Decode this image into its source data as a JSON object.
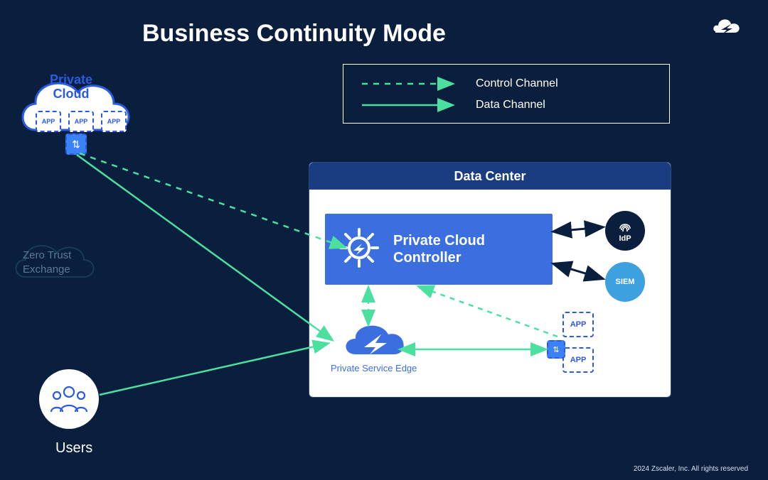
{
  "title": "Business Continuity Mode",
  "legend": {
    "control": "Control Channel",
    "data": "Data Channel"
  },
  "private_cloud": {
    "label_line1": "Private",
    "label_line2": "Cloud",
    "apps": [
      "APP",
      "APP",
      "APP"
    ]
  },
  "zero_trust": {
    "line1": "Zero Trust",
    "line2": "Exchange"
  },
  "users": {
    "label": "Users"
  },
  "data_center": {
    "header": "Data Center",
    "controller_line1": "Private Cloud",
    "controller_line2": "Controller",
    "idp": "IdP",
    "siem": "SIEM",
    "pse": "Private Service Edge",
    "apps": [
      "APP",
      "APP"
    ]
  },
  "footer": "2024 Zscaler, Inc. All rights reserved",
  "colors": {
    "control": "#4be0a0",
    "data": "#4be0a0",
    "black_arrow": "#0a1f3d",
    "blue": "#2a5ae0"
  }
}
